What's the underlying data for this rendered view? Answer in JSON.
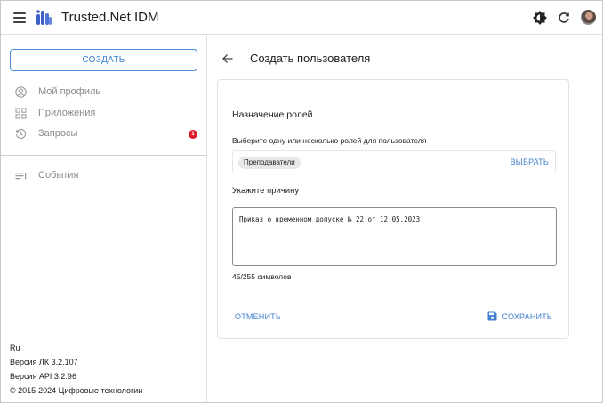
{
  "header": {
    "app_title": "Trusted.Net IDM"
  },
  "sidebar": {
    "create_label": "СОЗДАТЬ",
    "items": [
      {
        "label": "Мой профиль",
        "icon": "user-circle-icon"
      },
      {
        "label": "Приложения",
        "icon": "apps-grid-icon"
      },
      {
        "label": "Запросы",
        "icon": "history-icon",
        "badge": "1"
      },
      {
        "label": "События",
        "icon": "list-icon"
      }
    ],
    "footer": {
      "language": "Ru",
      "lk_version": "Версия ЛК 3.2.107",
      "api_version": "Версия API 3.2.96",
      "copyright": "© 2015-2024 Цифровые технологии"
    }
  },
  "main": {
    "title": "Создать пользователя",
    "form": {
      "section_title": "Назначение ролей",
      "roles_label": "Выберите одну или несколько ролей для пользователя",
      "selected_role": "Преподаватели",
      "select_label": "ВЫБРАТЬ",
      "reason_label": "Укажите причину",
      "reason_value": "Приказ о временном допуске № 22 от 12.05.2023",
      "counter": "45/255 символов",
      "cancel_label": "ОТМЕНИТЬ",
      "save_label": "СОХРАНИТЬ"
    }
  },
  "colors": {
    "accent": "#3f7fcf",
    "badge": "#d91b2a",
    "logo": "#3b5fc7"
  }
}
